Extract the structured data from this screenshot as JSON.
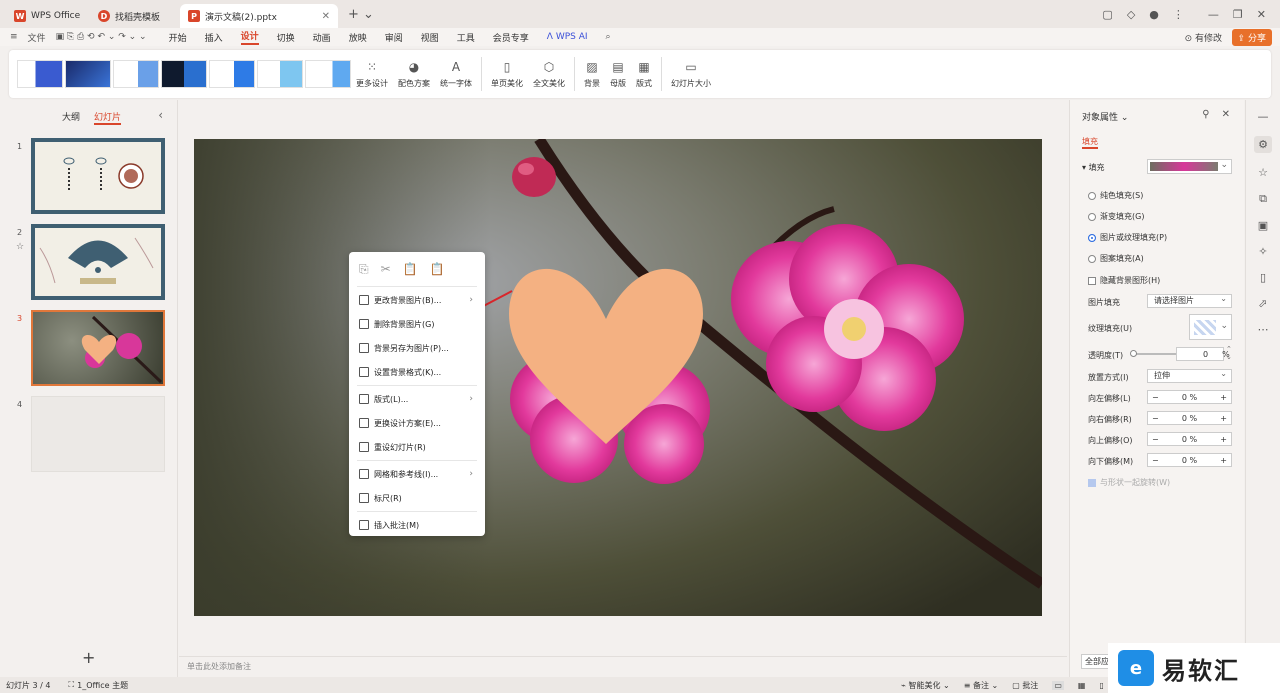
{
  "titlebar": {
    "tabs": [
      {
        "label": "WPS Office",
        "logo_color": "#d9462b"
      },
      {
        "label": "找稻壳模板",
        "logo_color": "#d9462b"
      },
      {
        "label": "演示文稿(2).pptx",
        "logo_color": "#d9462b"
      }
    ]
  },
  "menubar": {
    "file": "文件",
    "items": [
      "开始",
      "插入",
      "设计",
      "切换",
      "动画",
      "放映",
      "审阅",
      "视图",
      "工具",
      "会员专享"
    ],
    "active": "设计",
    "wps_ai": "WPS AI",
    "edit_mode": "有修改",
    "share": "分享"
  },
  "ribbon": {
    "more_design": "更多设计",
    "color_scheme": "配色方案",
    "unify_font": "统一字体",
    "single_beautify": "单页美化",
    "full_beautify": "全文美化",
    "background": "背景",
    "master": "母版",
    "layout": "版式",
    "slide_size": "幻灯片大小"
  },
  "leftpanel": {
    "tab_outline": "大纲",
    "tab_slides": "幻灯片",
    "slides": [
      "1",
      "2",
      "3",
      "4"
    ]
  },
  "notes_placeholder": "单击此处添加备注",
  "context_menu": {
    "items": [
      {
        "label": "更改背景图片(B)...",
        "submenu": true
      },
      {
        "label": "删除背景图片(G)",
        "submenu": false
      },
      {
        "label": "背景另存为图片(P)...",
        "submenu": false
      },
      {
        "label": "设置背景格式(K)...",
        "submenu": false
      },
      {
        "label": "版式(L)...",
        "submenu": true
      },
      {
        "label": "更换设计方案(E)...",
        "submenu": false
      },
      {
        "label": "重设幻灯片(R)",
        "submenu": false
      },
      {
        "label": "网格和参考线(I)...",
        "submenu": true
      },
      {
        "label": "标尺(R)",
        "submenu": false
      },
      {
        "label": "插入批注(M)",
        "submenu": false
      }
    ]
  },
  "rightpanel": {
    "title": "对象属性",
    "tab": "填充",
    "fill_section": "填充",
    "options": [
      "纯色填充(S)",
      "渐变填充(G)",
      "图片或纹理填充(P)",
      "图案填充(A)"
    ],
    "selected_option": 2,
    "hide_bg": "隐藏背景图形(H)",
    "picture_fill_label": "图片填充",
    "picture_fill_value": "请选择图片",
    "texture_label": "纹理填充(U)",
    "transparency_label": "透明度(T)",
    "transparency_value": "0",
    "transparency_unit": "%",
    "placement_label": "放置方式(I)",
    "placement_value": "拉伸",
    "offsets": [
      {
        "label": "向左偏移(L)",
        "value": "0",
        "unit": "%"
      },
      {
        "label": "向右偏移(R)",
        "value": "0",
        "unit": "%"
      },
      {
        "label": "向上偏移(O)",
        "value": "0",
        "unit": "%"
      },
      {
        "label": "向下偏移(M)",
        "value": "0",
        "unit": "%"
      }
    ],
    "rotate_with_shape": "与形状一起旋转(W)",
    "full_apply": "全部应"
  },
  "statusbar": {
    "slide_info": "幻灯片 3 / 4",
    "theme": "1_Office 主题",
    "smart_beautify": "智能美化",
    "notes": "备注",
    "comments": "批注"
  },
  "watermark": {
    "text": "易软汇"
  },
  "colors": {
    "accent": "#d9462b",
    "heart": "#f4b182"
  }
}
